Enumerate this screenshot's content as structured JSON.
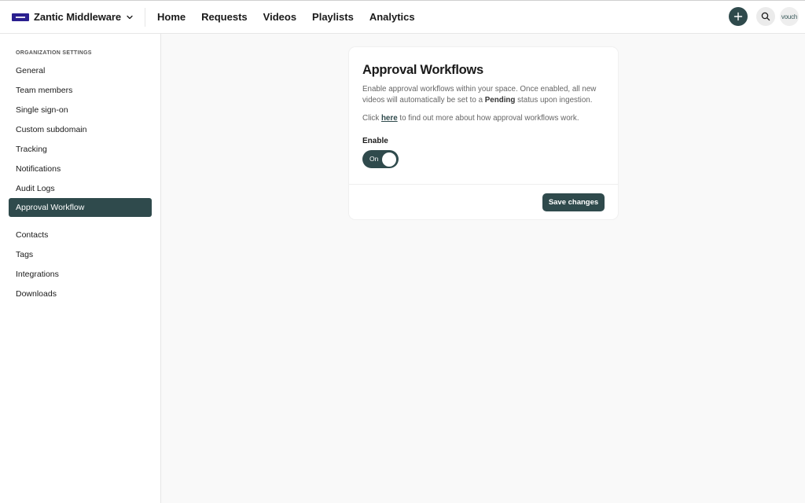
{
  "header": {
    "org_name": "Zantic Middleware",
    "nav": [
      "Home",
      "Requests",
      "Videos",
      "Playlists",
      "Analytics"
    ],
    "avatar_text": "vouch",
    "accent_color": "#2f4a4c",
    "logo_color": "#2a1f8f"
  },
  "sidebar": {
    "heading": "ORGANIZATION SETTINGS",
    "items": [
      {
        "label": "General",
        "active": false
      },
      {
        "label": "Team members",
        "active": false
      },
      {
        "label": "Single sign-on",
        "active": false
      },
      {
        "label": "Custom subdomain",
        "active": false
      },
      {
        "label": "Tracking",
        "active": false
      },
      {
        "label": "Notifications",
        "active": false
      },
      {
        "label": "Audit Logs",
        "active": false
      },
      {
        "label": "Approval Workflow",
        "active": true
      },
      {
        "label": "Contacts",
        "active": false
      },
      {
        "label": "Tags",
        "active": false
      },
      {
        "label": "Integrations",
        "active": false
      },
      {
        "label": "Downloads",
        "active": false
      }
    ]
  },
  "card": {
    "title": "Approval Workflows",
    "desc_before": "Enable approval workflows within your space. Once enabled, all new videos will automatically be set to a ",
    "desc_bold": "Pending",
    "desc_after": " status upon ingestion.",
    "help_before": "Click ",
    "help_link": "here",
    "help_after": " to find out more about how approval workflows work.",
    "enable_label": "Enable",
    "toggle_text": "On",
    "toggle_on": true,
    "save_label": "Save changes"
  }
}
